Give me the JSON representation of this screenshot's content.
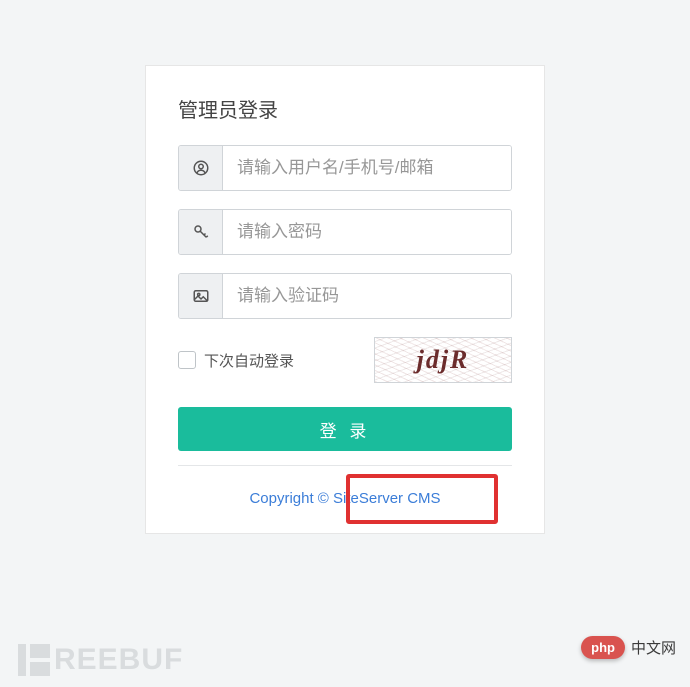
{
  "card": {
    "title": "管理员登录",
    "username_placeholder": "请输入用户名/手机号/邮箱",
    "password_placeholder": "请输入密码",
    "captcha_placeholder": "请输入验证码",
    "captcha_text": "jdjR",
    "remember_label": "下次自动登录",
    "login_button": "登 录",
    "copyright": "Copyright © SiteServer CMS"
  },
  "watermarks": {
    "freebuf": "REEBUF",
    "php_pill": "php",
    "php_text": "中文网"
  }
}
